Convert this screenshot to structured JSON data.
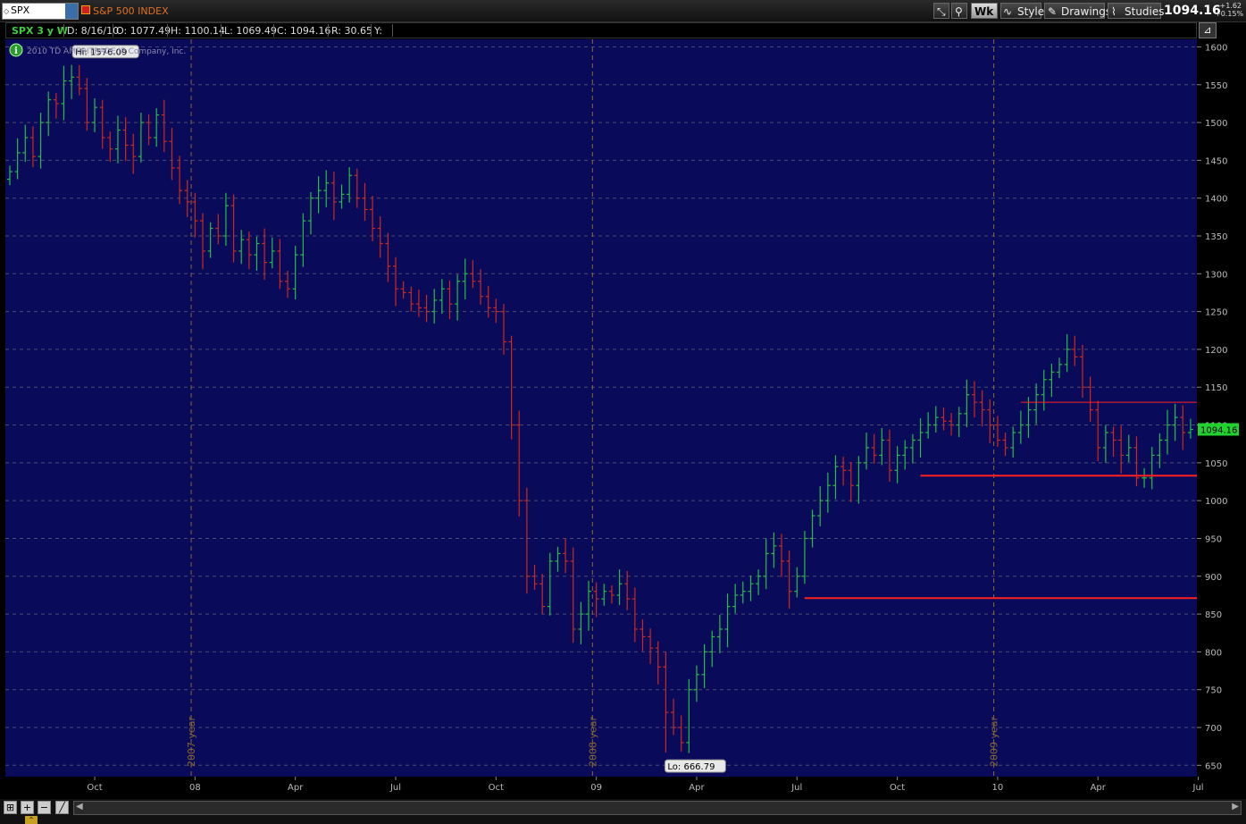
{
  "toolbar": {
    "symbol": "SPX",
    "symbol_name": "S&P 500 INDEX",
    "timeframe_label": "Wk",
    "style_label": "Style",
    "drawings_label": "Drawings",
    "studies_label": "Studies",
    "last_price": "1094.16",
    "change": "+1.62",
    "change_pct": "+0.15%"
  },
  "infobar": {
    "chart_label": "SPX 3 y W",
    "date": "D: 8/16/10",
    "open": "O: 1077.49",
    "high": "H: 1100.14",
    "low": "L: 1069.49",
    "close": "C: 1094.16",
    "range": "R: 30.65",
    "y": "Y:"
  },
  "copyright": "2010 TD AMERITRADE IP Company, Inc.",
  "colors": {
    "background": "#0a0a5a",
    "up": "#22c040",
    "down": "#d02818",
    "grid": "#4a4a6a",
    "year_line": "#8a6a30",
    "support_line": "#ff2020"
  },
  "chart_data": {
    "type": "ohlc",
    "ylim": [
      635,
      1610
    ],
    "y_ticks": [
      650,
      700,
      750,
      800,
      850,
      900,
      950,
      1000,
      1050,
      1100,
      1150,
      1200,
      1250,
      1300,
      1350,
      1400,
      1450,
      1500,
      1550,
      1600
    ],
    "x_ticks": [
      {
        "label": "Oct",
        "week": 11
      },
      {
        "label": "08",
        "week": 24
      },
      {
        "label": "Apr",
        "week": 37
      },
      {
        "label": "Jul",
        "week": 50
      },
      {
        "label": "Oct",
        "week": 63
      },
      {
        "label": "09",
        "week": 76
      },
      {
        "label": "Apr",
        "week": 89
      },
      {
        "label": "Jul",
        "week": 102
      },
      {
        "label": "Oct",
        "week": 115
      },
      {
        "label": "10",
        "week": 128
      },
      {
        "label": "Apr",
        "week": 141
      },
      {
        "label": "Jul",
        "week": 154
      }
    ],
    "year_markers": [
      {
        "label": "2007 year",
        "week": 23.5
      },
      {
        "label": "2008 year",
        "week": 75.5
      },
      {
        "label": "2009 year",
        "week": 127.5
      }
    ],
    "hi_label": "Hi: 1576.09",
    "hi_value": 1576.09,
    "hi_week": 8,
    "lo_label": "Lo: 666.79",
    "lo_value": 666.79,
    "lo_week": 85,
    "last_label": "1094.16",
    "last_value": 1094.16,
    "horizontal_lines": [
      {
        "y": 1130,
        "from_week": 131
      },
      {
        "y": 1033,
        "from_week": 118
      },
      {
        "y": 871,
        "from_week": 103
      }
    ],
    "closes": [
      1435,
      1460,
      1480,
      1455,
      1500,
      1530,
      1525,
      1555,
      1560,
      1545,
      1500,
      1520,
      1480,
      1465,
      1490,
      1470,
      1455,
      1500,
      1480,
      1510,
      1475,
      1440,
      1410,
      1395,
      1370,
      1330,
      1360,
      1350,
      1390,
      1330,
      1345,
      1325,
      1340,
      1315,
      1330,
      1290,
      1280,
      1325,
      1370,
      1400,
      1410,
      1420,
      1395,
      1405,
      1430,
      1400,
      1385,
      1360,
      1340,
      1310,
      1280,
      1275,
      1260,
      1255,
      1250,
      1265,
      1280,
      1260,
      1290,
      1300,
      1290,
      1270,
      1255,
      1250,
      1210,
      1100,
      1000,
      900,
      890,
      860,
      920,
      930,
      920,
      830,
      850,
      880,
      870,
      880,
      875,
      890,
      870,
      830,
      820,
      805,
      780,
      720,
      700,
      680,
      750,
      770,
      800,
      820,
      830,
      860,
      875,
      880,
      890,
      900,
      930,
      940,
      920,
      880,
      900,
      950,
      980,
      1000,
      1020,
      1045,
      1040,
      1020,
      1050,
      1070,
      1060,
      1080,
      1040,
      1060,
      1070,
      1080,
      1090,
      1100,
      1110,
      1105,
      1100,
      1115,
      1140,
      1130,
      1120,
      1100,
      1080,
      1070,
      1090,
      1100,
      1120,
      1140,
      1160,
      1170,
      1180,
      1200,
      1190,
      1150,
      1120,
      1070,
      1090,
      1080,
      1060,
      1070,
      1030,
      1030,
      1060,
      1080,
      1100,
      1110,
      1090,
      1094.16
    ]
  }
}
